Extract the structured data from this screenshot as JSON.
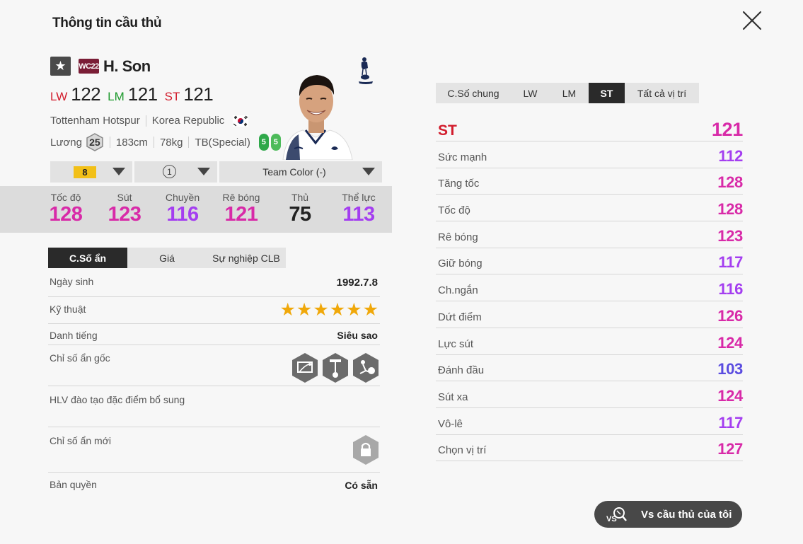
{
  "window": {
    "title": "Thông tin cầu thủ"
  },
  "player": {
    "season": "WC22",
    "name": "H. Son",
    "positions": [
      {
        "label": "LW",
        "value": "122",
        "color": "#d21c2c"
      },
      {
        "label": "LM",
        "value": "121",
        "color": "#1f9a2e"
      },
      {
        "label": "ST",
        "value": "121",
        "color": "#d21c2c"
      }
    ],
    "club": "Tottenham Hotspur",
    "nation": "Korea Republic",
    "salary_label": "Lương",
    "salary": "25",
    "height": "183cm",
    "weight": "78kg",
    "body_type": "TB(Special)",
    "weak_foot": "5",
    "strong_foot": "5"
  },
  "selectors": {
    "upgrade": "8",
    "level": "1",
    "team_color": "Team Color (-)"
  },
  "summary": [
    {
      "label": "Tốc độ",
      "value": "128",
      "color": "#d82aa8"
    },
    {
      "label": "Sút",
      "value": "123",
      "color": "#d82aa8"
    },
    {
      "label": "Chuyền",
      "value": "116",
      "color": "#a43ef0"
    },
    {
      "label": "Rê bóng",
      "value": "121",
      "color": "#d82aa8"
    },
    {
      "label": "Thủ",
      "value": "75",
      "color": "#222222"
    },
    {
      "label": "Thể lực",
      "value": "113",
      "color": "#a43ef0"
    }
  ],
  "left_tabs": [
    "C.Số ẩn",
    "Giá",
    "Sự nghiệp CLB"
  ],
  "details": {
    "birth_label": "Ngày sinh",
    "birth_value": "1992.7.8",
    "skill_label": "Kỹ thuật",
    "skill_stars": 6,
    "fame_label": "Danh tiếng",
    "fame_value": "Siêu sao",
    "traits_label": "Chỉ số ẩn gốc",
    "traits_icons": [
      "finesse-shot-icon",
      "speed-dribbler-icon",
      "flair-icon"
    ],
    "coach_label": "HLV đào tạo đặc điểm bổ sung",
    "new_traits_label": "Chỉ số ẩn mới",
    "license_label": "Bản quyền",
    "license_value": "Có sẵn"
  },
  "right_tabs": [
    "C.Số chung",
    "LW",
    "LM",
    "ST",
    "Tất cả vị trí"
  ],
  "stats_header": {
    "label": "ST",
    "value": "121",
    "color": "#d82aa8"
  },
  "stats": [
    {
      "label": "Sức mạnh",
      "value": "112",
      "color": "#a43ef0"
    },
    {
      "label": "Tăng tốc",
      "value": "128",
      "color": "#d82aa8"
    },
    {
      "label": "Tốc độ",
      "value": "128",
      "color": "#d82aa8"
    },
    {
      "label": "Rê bóng",
      "value": "123",
      "color": "#d82aa8"
    },
    {
      "label": "Giữ bóng",
      "value": "117",
      "color": "#a43ef0"
    },
    {
      "label": "Ch.ngắn",
      "value": "116",
      "color": "#a43ef0"
    },
    {
      "label": "Dứt điểm",
      "value": "126",
      "color": "#d82aa8"
    },
    {
      "label": "Lực sút",
      "value": "124",
      "color": "#d82aa8"
    },
    {
      "label": "Đánh đầu",
      "value": "103",
      "color": "#5a4ce0"
    },
    {
      "label": "Sút xa",
      "value": "124",
      "color": "#d82aa8"
    },
    {
      "label": "Vô-lê",
      "value": "117",
      "color": "#a43ef0"
    },
    {
      "label": "Chọn vị trí",
      "value": "127",
      "color": "#d82aa8"
    }
  ],
  "vs_button": "Vs cầu thủ của tôi"
}
